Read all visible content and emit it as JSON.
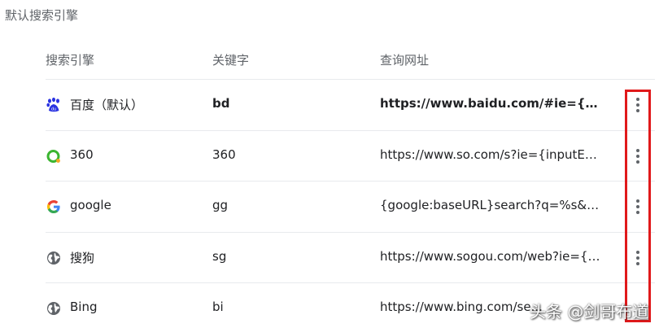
{
  "section": {
    "title": "默认搜索引擎"
  },
  "columns": {
    "engine": "搜索引擎",
    "keyword": "关键字",
    "url": "查询网址"
  },
  "engines": [
    {
      "name": "百度（默认）",
      "keyword": "bd",
      "url": "https://www.baidu.com/#ie={inputE...",
      "icon": "baidu-icon",
      "is_default": true
    },
    {
      "name": "360",
      "keyword": "360",
      "url": "https://www.so.com/s?ie={inputEnc...",
      "icon": "360-icon",
      "is_default": false
    },
    {
      "name": "google",
      "keyword": "gg",
      "url": "{google:baseURL}search?q=%s&{go...",
      "icon": "google-icon",
      "is_default": false
    },
    {
      "name": "搜狗",
      "keyword": "sg",
      "url": "https://www.sogou.com/web?ie={in...",
      "icon": "globe-icon",
      "is_default": false
    },
    {
      "name": "Bing",
      "keyword": "bi",
      "url": "https://www.bing.com/se...",
      "icon": "globe-icon",
      "is_default": false
    }
  ],
  "more_icon": "more-vert-icon",
  "highlight_color": "#e0191b",
  "watermark": "头条 @剑哥布道"
}
